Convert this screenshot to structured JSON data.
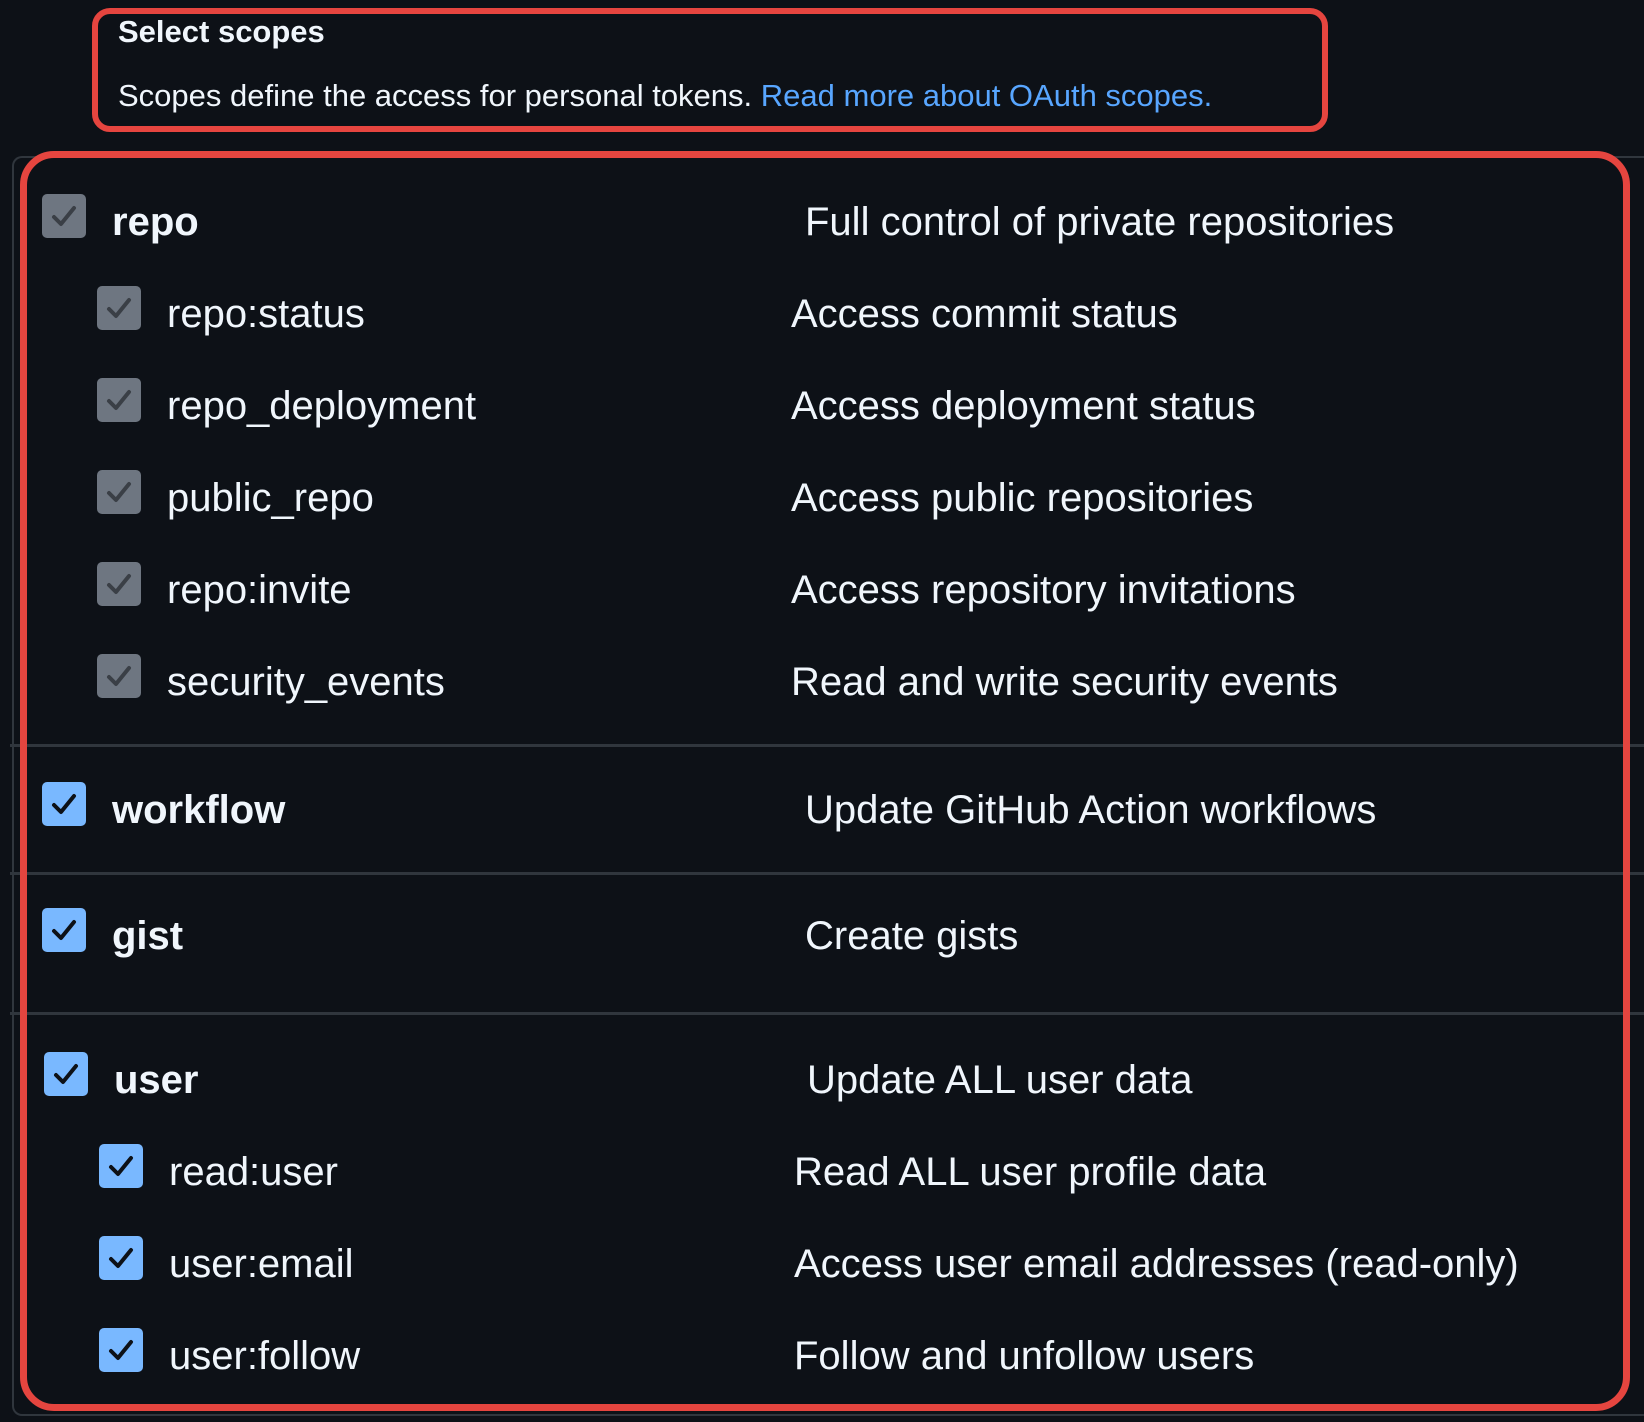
{
  "header": {
    "title": "Select scopes",
    "description": "Scopes define the access for personal tokens.",
    "link_label": "Read more about OAuth scopes."
  },
  "scopes": [
    {
      "name": "repo",
      "description": "Full control of private repositories",
      "checked": true,
      "disabled": true,
      "children": [
        {
          "name": "repo:status",
          "description": "Access commit status",
          "checked": true,
          "disabled": true
        },
        {
          "name": "repo_deployment",
          "description": "Access deployment status",
          "checked": true,
          "disabled": true
        },
        {
          "name": "public_repo",
          "description": "Access public repositories",
          "checked": true,
          "disabled": true
        },
        {
          "name": "repo:invite",
          "description": "Access repository invitations",
          "checked": true,
          "disabled": true
        },
        {
          "name": "security_events",
          "description": "Read and write security events",
          "checked": true,
          "disabled": true
        }
      ]
    },
    {
      "name": "workflow",
      "description": "Update GitHub Action workflows",
      "checked": true,
      "disabled": false,
      "children": []
    },
    {
      "name": "gist",
      "description": "Create gists",
      "checked": true,
      "disabled": false,
      "children": []
    },
    {
      "name": "user",
      "description": "Update ALL user data",
      "checked": true,
      "disabled": false,
      "children": [
        {
          "name": "read:user",
          "description": "Read ALL user profile data",
          "checked": true,
          "disabled": false
        },
        {
          "name": "user:email",
          "description": "Access user email addresses (read-only)",
          "checked": true,
          "disabled": false
        },
        {
          "name": "user:follow",
          "description": "Follow and unfollow users",
          "checked": true,
          "disabled": false
        }
      ]
    }
  ],
  "colors": {
    "background": "#0d1117",
    "annotation": "#e5453f",
    "link": "#58a6ff",
    "checkbox_checked": "#79b8ff",
    "checkbox_disabled": "#6e7681",
    "divider": "#30363d"
  }
}
